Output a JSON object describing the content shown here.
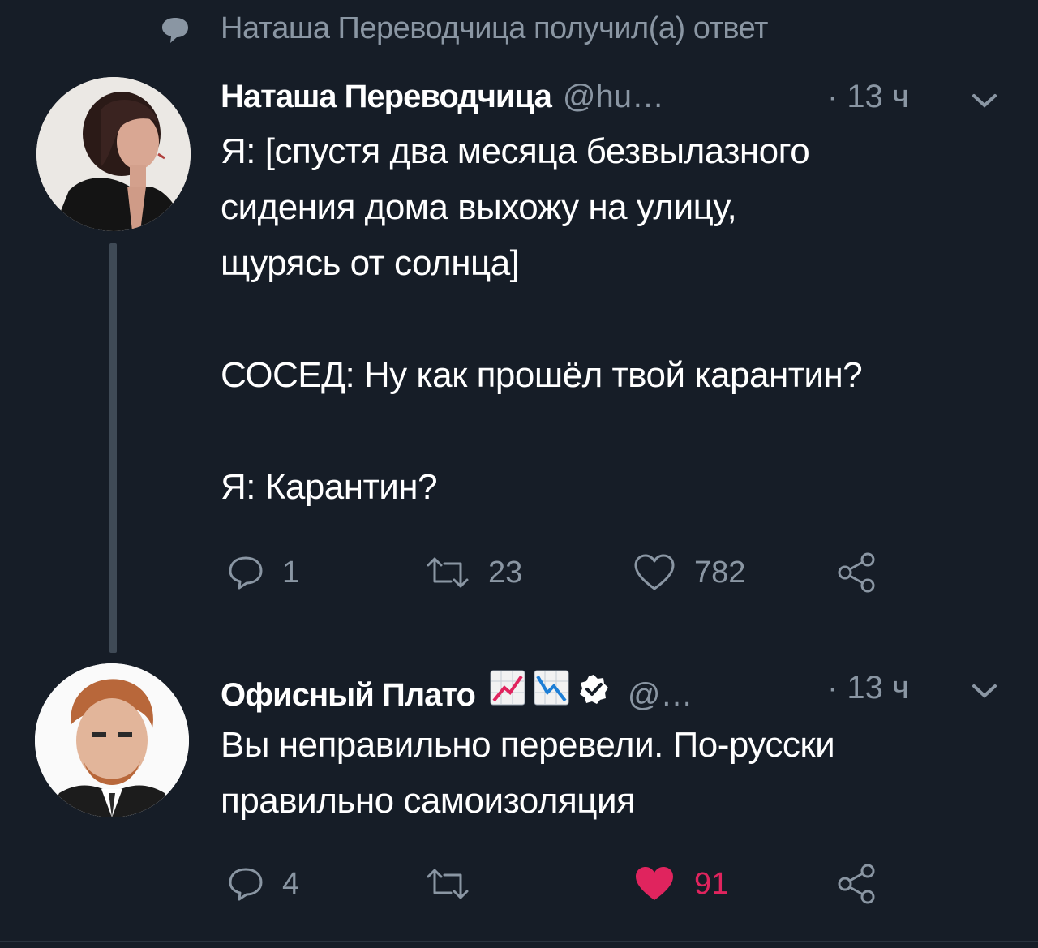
{
  "context_line": {
    "text": "Наташа Переводчица получил(а) ответ",
    "icon": "speech-bubble-icon"
  },
  "tweets": [
    {
      "name": "Наташа Переводчица",
      "handle": "@hu…",
      "time": "· 13 ч",
      "text_lines": [
        "Я: [спустя два месяца безвылазного",
        "сидения дома выхожу на улицу,",
        "щурясь от солнца]",
        "",
        "СОСЕД: Ну как прошёл твой карантин?",
        "",
        "Я: Карантин?"
      ],
      "actions": {
        "reply_count": "1",
        "retweet_count": "23",
        "like_count": "782",
        "liked": false
      }
    },
    {
      "name": "Офисный Плато",
      "handle": "@…",
      "time": "· 13 ч",
      "verified": true,
      "name_emojis": [
        "chart-increasing-icon",
        "chart-decreasing-icon"
      ],
      "text_lines": [
        "Вы неправильно перевели. По-русски",
        "правильно самоизоляция"
      ],
      "actions": {
        "reply_count": "4",
        "retweet_count": "",
        "like_count": "91",
        "liked": true
      }
    }
  ],
  "colors": {
    "background": "#161d27",
    "text_primary": "#ffffff",
    "text_secondary": "#8a96a3",
    "like_active": "#e0245e",
    "thread_line": "#3f4a56"
  }
}
